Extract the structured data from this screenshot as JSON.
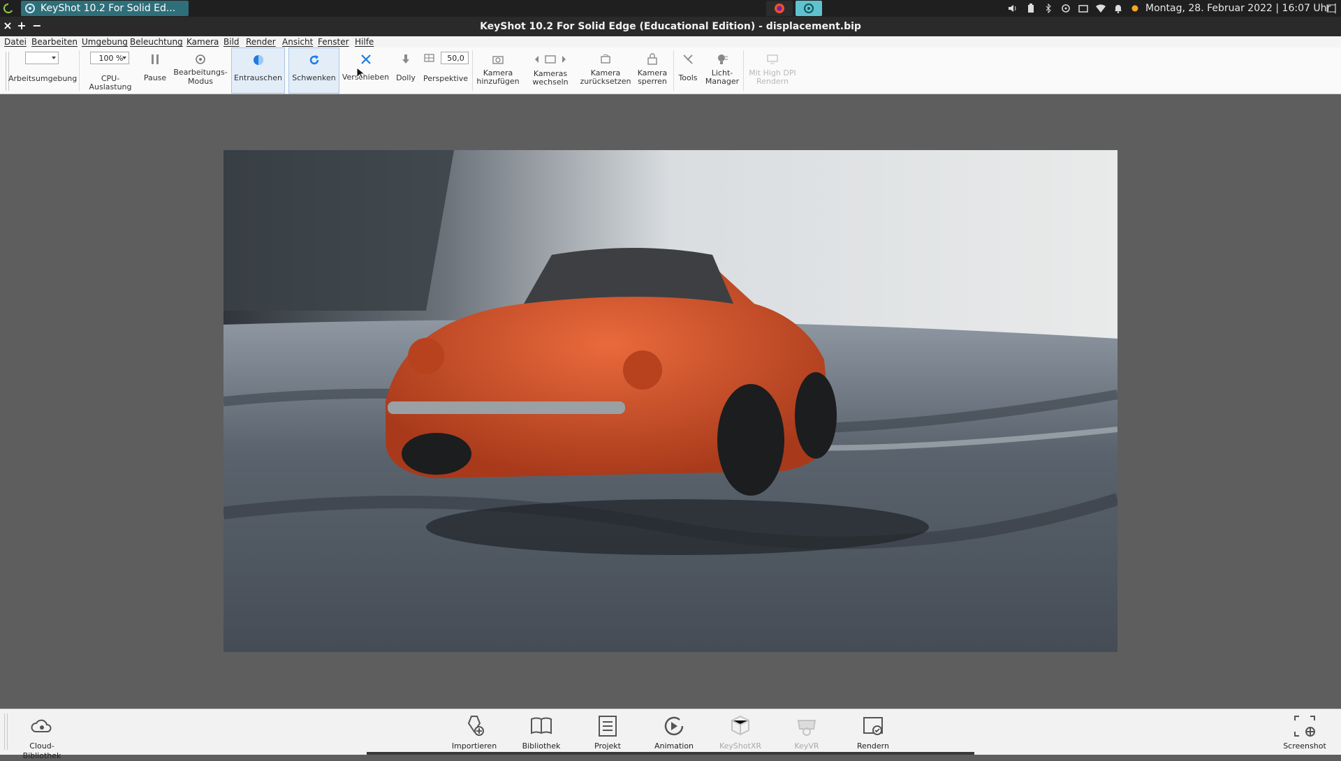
{
  "system_panel": {
    "taskbar_item": "KeyShot 10.2 For Solid Ed...",
    "clock": "Montag, 28. Februar 2022 | 16:07 Uhr |"
  },
  "window": {
    "title": "KeyShot 10.2 For Solid Edge (Educational Edition) - displacement.bip",
    "controls": [
      "×",
      "+",
      "−"
    ]
  },
  "menu": [
    "Datei",
    "Bearbeiten",
    "Umgebung",
    "Beleuchtung",
    "Kamera",
    "Bild",
    "Render",
    "Ansicht",
    "Fenster",
    "Hilfe"
  ],
  "ribbon": {
    "arbeitsumgebung": "Arbeitsumgebung",
    "cpu_value": "100 %",
    "cpu": "CPU-Auslastung",
    "pause": "Pause",
    "bearbeitungs_1": "Bearbeitungs-",
    "bearbeitungs_2": "Modus",
    "entrauschen": "Entrauschen",
    "schwenken": "Schwenken",
    "verschieben": "Verschieben",
    "dolly": "Dolly",
    "perspektive_value": "50,0",
    "perspektive": "Perspektive",
    "kamera_add_1": "Kamera",
    "kamera_add_2": "hinzufügen",
    "kameras_1": "Kameras",
    "kameras_2": "wechseln",
    "kamera_reset_1": "Kamera",
    "kamera_reset_2": "zurücksetzen",
    "kamera_lock_1": "Kamera",
    "kamera_lock_2": "sperren",
    "tools": "Tools",
    "licht_1": "Licht-",
    "licht_2": "Manager",
    "hidpi_1": "Mit High DPI",
    "hidpi_2": "Rendern"
  },
  "dock": {
    "cloud": "Cloud-Bibliothek",
    "importieren": "Importieren",
    "bibliothek": "Bibliothek",
    "projekt": "Projekt",
    "animation": "Animation",
    "keyshotxr": "KeyShotXR",
    "keyvr": "KeyVR",
    "rendern": "Rendern",
    "screenshot": "Screenshot"
  },
  "colors": {
    "accent": "#2e6f7a",
    "active_tab": "#e3edf8",
    "car": "#d8542a"
  }
}
